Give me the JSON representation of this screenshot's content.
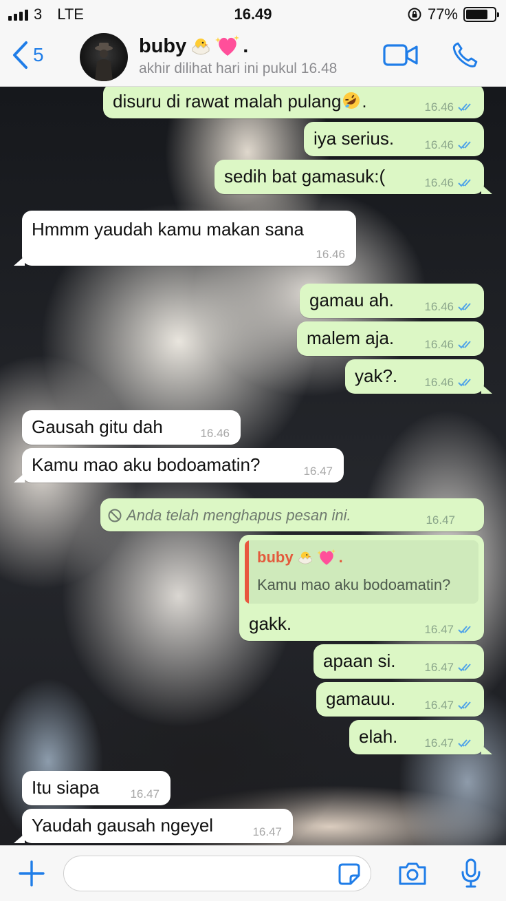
{
  "status_bar": {
    "carrier": "3",
    "network": "LTE",
    "time": "16.49",
    "battery_text": "77%",
    "battery_level": 0.77
  },
  "header": {
    "back_count": "5",
    "contact_name": "buby",
    "contact_name_suffix": ".",
    "status": "akhir dilihat hari ini pukul 16.48"
  },
  "colors": {
    "accent": "#1f7de8",
    "outgoing_bubble": "#dcf7c5",
    "incoming_bubble": "#ffffff",
    "read_ticks": "#4fa3e8",
    "quote_name": "#e35a3c"
  },
  "messages": [
    {
      "dir": "out",
      "text": "disuru di rawat malah pulang",
      "emoji_after": "rofl",
      "suffix": ".",
      "time": "16.46"
    },
    {
      "dir": "out",
      "text": "iya serius.",
      "time": "16.46"
    },
    {
      "dir": "out",
      "text": "sedih bat gamasuk:(",
      "time": "16.46"
    },
    {
      "dir": "in",
      "text": "Hmmm yaudah kamu makan sana",
      "time": "16.46"
    },
    {
      "dir": "out",
      "text": "gamau ah.",
      "time": "16.46"
    },
    {
      "dir": "out",
      "text": "malem aja.",
      "time": "16.46"
    },
    {
      "dir": "out",
      "text": "yak?.",
      "time": "16.46"
    },
    {
      "dir": "in",
      "text": "Gausah gitu dah",
      "time": "16.46"
    },
    {
      "dir": "in",
      "text": "Kamu mao aku bodoamatin?",
      "time": "16.47"
    },
    {
      "dir": "out",
      "text": "Anda telah menghapus pesan ini.",
      "time": "16.47",
      "deleted": true
    },
    {
      "dir": "out",
      "text": "gakk.",
      "time": "16.47",
      "quote": {
        "name": "buby",
        "name_suffix": ".",
        "text": "Kamu mao aku bodoamatin?"
      }
    },
    {
      "dir": "out",
      "text": "apaan si.",
      "time": "16.47"
    },
    {
      "dir": "out",
      "text": "gamauu.",
      "time": "16.47"
    },
    {
      "dir": "out",
      "text": "elah.",
      "time": "16.47"
    },
    {
      "dir": "in",
      "text": "Itu siapa",
      "time": "16.47"
    },
    {
      "dir": "in",
      "text": "Yaudah gausah ngeyel",
      "time": "16.47"
    }
  ],
  "input_bar": {
    "value": "",
    "icons": [
      "plus-icon",
      "sticker-icon",
      "camera-icon",
      "microphone-icon"
    ]
  }
}
